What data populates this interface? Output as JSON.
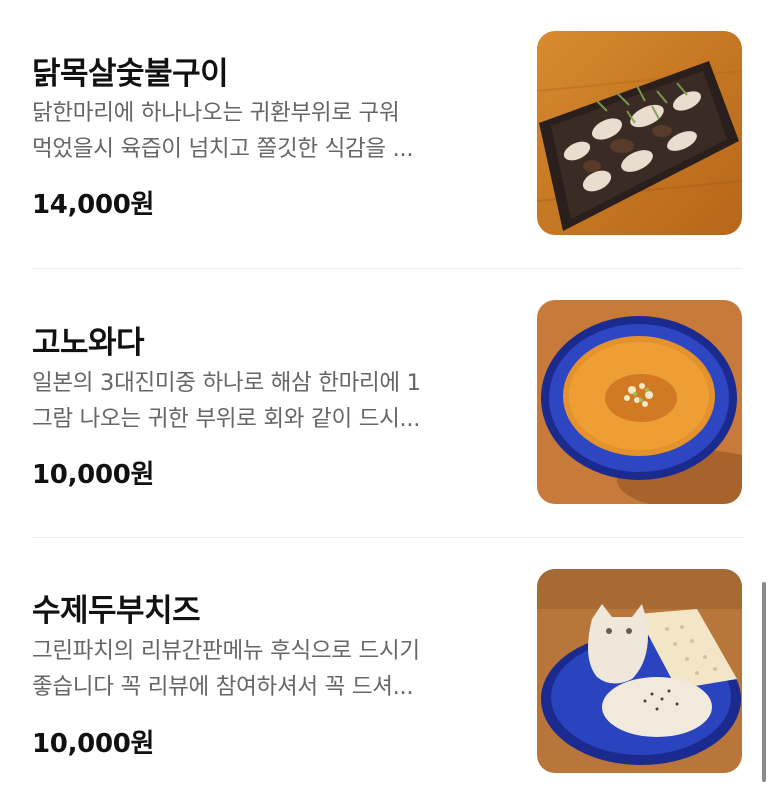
{
  "menu": {
    "items": [
      {
        "name": "닭목살숯불구이",
        "desc_line1": "닭한마리에 하나나오는 귀환부위로 구워",
        "desc_line2": "먹었을시 육즙이 넘치고 쫄깃한 식감을 ...",
        "price": "14,000원",
        "image_subject": "grilled-chicken-neck-photo"
      },
      {
        "name": "고노와다",
        "desc_line1": "일본의 3대진미중 하나로 해삼 한마리에 1",
        "desc_line2": "그람 나오는 귀한 부위로 회와 같이 드시...",
        "price": "10,000원",
        "image_subject": "konowata-bowl-photo"
      },
      {
        "name": "수제두부치즈",
        "desc_line1": "그린파치의 리뷰간판메뉴 후식으로 드시기",
        "desc_line2": "좋습니다 꼭 리뷰에 참여하셔서 꼭 드셔...",
        "price": "10,000원",
        "image_subject": "tofu-cheese-crackers-photo"
      }
    ]
  },
  "colors": {
    "title": "#111111",
    "description": "#666666",
    "divider": "#ececec",
    "scrollbar": "#8a8a8a"
  }
}
